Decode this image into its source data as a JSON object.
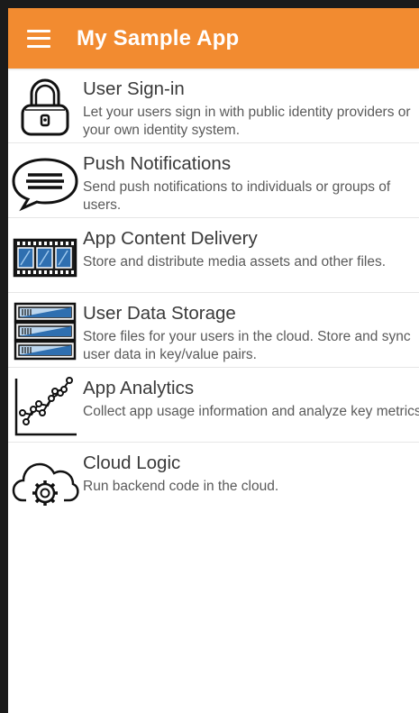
{
  "appbar": {
    "title": "My Sample App",
    "color": "#f28b30",
    "menu_icon": "hamburger-menu-icon"
  },
  "features": [
    {
      "icon": "padlock-icon",
      "title": "User Sign-in",
      "description": "Let your users sign in with public identity providers or your own identity system."
    },
    {
      "icon": "chat-bubble-icon",
      "title": "Push Notifications",
      "description": "Send push notifications to individuals or groups of users."
    },
    {
      "icon": "film-strip-icon",
      "title": "App Content Delivery",
      "description": "Store and distribute media assets and other files."
    },
    {
      "icon": "server-storage-icon",
      "title": "User Data Storage",
      "description": "Store files for your users in the cloud. Store and sync user data in key/value pairs."
    },
    {
      "icon": "line-chart-icon",
      "title": "App Analytics",
      "description": "Collect app usage information and analyze key metrics."
    },
    {
      "icon": "cloud-gear-icon",
      "title": "Cloud Logic",
      "description": "Run backend code in the cloud."
    }
  ]
}
